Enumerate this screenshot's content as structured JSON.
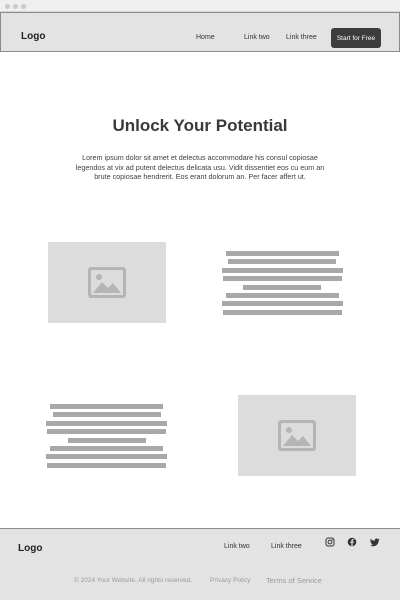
{
  "header": {
    "logo": "Logo",
    "nav": [
      "Home",
      "Link two",
      "Link three"
    ],
    "cta_label": "Start for Free"
  },
  "hero": {
    "title": "Unlock Your Potential",
    "text": "Lorem ipsum dolor sit amet et delectus accommodare his consul copiosae legendos at vix ad putent delectus delicata usu. Vidit dissentiet eos cu eum an brute copiosae hendrerit. Eos erant dolorum an. Per facer affert ut."
  },
  "sections": [
    {
      "image": "image-placeholder-icon"
    },
    {
      "image": "image-placeholder-icon"
    }
  ],
  "footer": {
    "logo": "Logo",
    "links": [
      "Link two",
      "Link three"
    ],
    "social": [
      "instagram-icon",
      "facebook-icon",
      "twitter-icon"
    ],
    "copyright": "© 2024 Your Website. All rights reserved.",
    "privacy": "Privacy Policy",
    "terms": "Terms of Service"
  },
  "colors": {
    "header_bg": "#e3e3e3",
    "cta_bg": "#3c3c3c",
    "placeholder_bg": "#dcdcdc",
    "line_gray": "#a8a8a8"
  }
}
